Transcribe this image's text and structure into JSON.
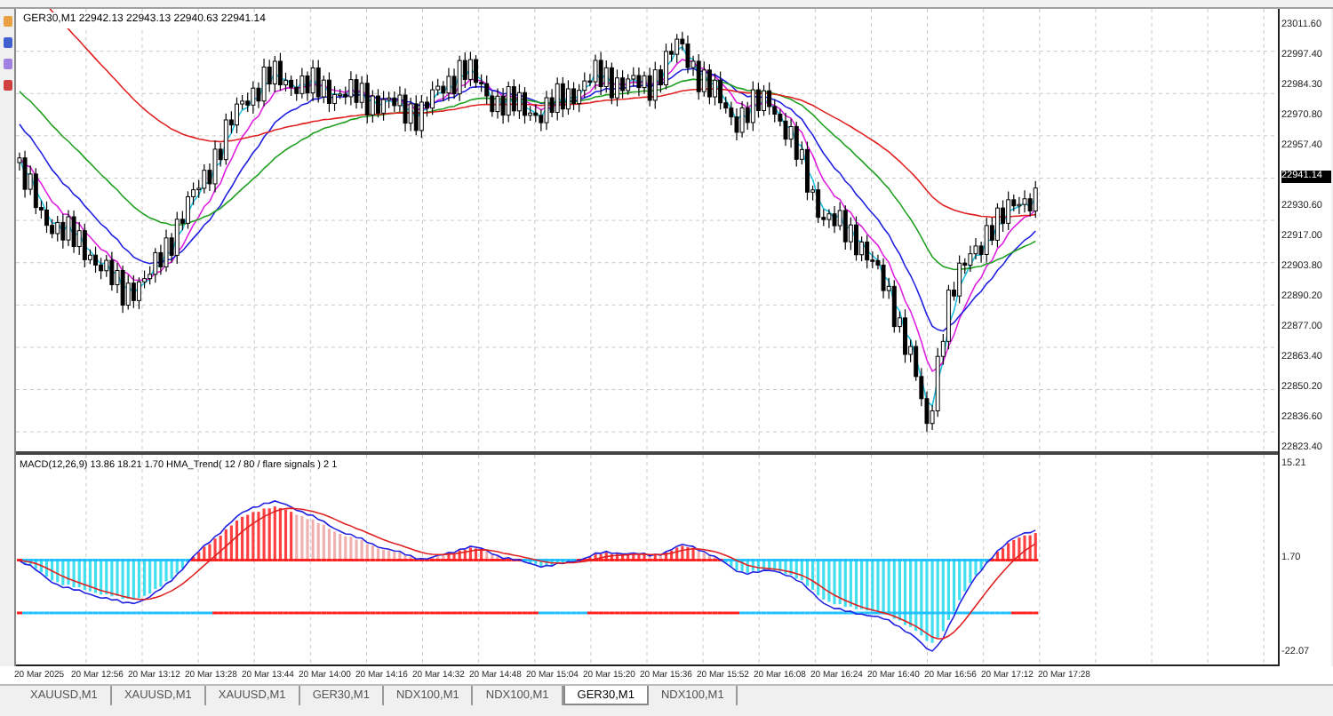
{
  "chart": {
    "header": "GER30,M1  22942.13 22943.13 22940.63 22941.14",
    "price_labels": [
      {
        "text": "23011.60",
        "current": false
      },
      {
        "text": "22997.40",
        "current": false
      },
      {
        "text": "22984.30",
        "current": false
      },
      {
        "text": "22970.80",
        "current": false
      },
      {
        "text": "22957.40",
        "current": false
      },
      {
        "text": "22941.14",
        "current": true
      },
      {
        "text": "22930.60",
        "current": false
      },
      {
        "text": "22917.00",
        "current": false
      },
      {
        "text": "22903.80",
        "current": false
      },
      {
        "text": "22890.20",
        "current": false
      },
      {
        "text": "22877.00",
        "current": false
      },
      {
        "text": "22863.40",
        "current": false
      },
      {
        "text": "22850.20",
        "current": false
      },
      {
        "text": "22836.60",
        "current": false
      },
      {
        "text": "22823.40",
        "current": false
      }
    ],
    "indicator_label": "MACD(12,26,9) 13.86 18.21 1.70  HMA_Trend( 12 / 80 / flare signals ) 2 1",
    "indicator_scale": [
      "15.21",
      "1.70",
      "-22.07"
    ],
    "time_labels": [
      "20 Mar 2025",
      "20 Mar 12:56",
      "20 Mar 13:12",
      "20 Mar 13:28",
      "20 Mar 13:44",
      "20 Mar 14:00",
      "20 Mar 14:16",
      "20 Mar 14:32",
      "20 Mar 14:48",
      "20 Mar 15:04",
      "20 Mar 15:20",
      "20 Mar 15:36",
      "20 Mar 15:52",
      "20 Mar 16:08",
      "20 Mar 16:24",
      "20 Mar 16:40",
      "20 Mar 16:56",
      "20 Mar 17:12",
      "20 Mar 17:28"
    ]
  },
  "tabs": [
    {
      "label": "XAUUSD,M1",
      "selected": false
    },
    {
      "label": "XAUUSD,M1",
      "selected": false
    },
    {
      "label": "XAUUSD,M1",
      "selected": false
    },
    {
      "label": "GER30,M1",
      "selected": false
    },
    {
      "label": "NDX100,M1",
      "selected": false
    },
    {
      "label": "NDX100,M1",
      "selected": false
    },
    {
      "label": "GER30,M1",
      "selected": true
    },
    {
      "label": "NDX100,M1",
      "selected": false
    }
  ]
}
